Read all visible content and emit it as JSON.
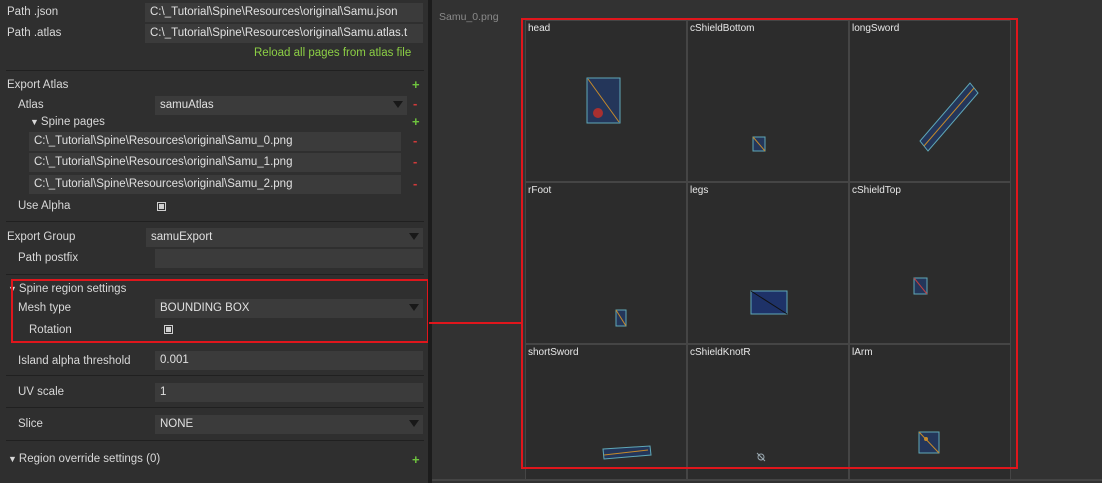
{
  "paths": {
    "json_label": "Path .json",
    "json_value": "C:\\_Tutorial\\Spine\\Resources\\original\\Samu.json",
    "atlas_label": "Path .atlas",
    "atlas_value": "C:\\_Tutorial\\Spine\\Resources\\original\\Samu.atlas.t",
    "reload_link": "Reload all pages from atlas file"
  },
  "export_atlas": {
    "label": "Export Atlas",
    "atlas_label": "Atlas",
    "atlas_value": "samuAtlas",
    "spine_pages_label": "Spine pages",
    "pages": [
      "C:\\_Tutorial\\Spine\\Resources\\original\\Samu_0.png",
      "C:\\_Tutorial\\Spine\\Resources\\original\\Samu_1.png",
      "C:\\_Tutorial\\Spine\\Resources\\original\\Samu_2.png"
    ],
    "use_alpha_label": "Use Alpha",
    "use_alpha_checked": true
  },
  "export_group": {
    "label": "Export Group",
    "value": "samuExport",
    "postfix_label": "Path postfix",
    "postfix_value": ""
  },
  "region_settings": {
    "label": "Spine region settings",
    "mesh_label": "Mesh type",
    "mesh_value": "BOUNDING BOX",
    "rotation_label": "Rotation",
    "rotation_checked": true
  },
  "island": {
    "label": "Island alpha threshold",
    "value": "0.001"
  },
  "uv": {
    "label": "UV scale",
    "value": "1"
  },
  "slice": {
    "label": "Slice",
    "value": "NONE"
  },
  "override": {
    "label": "Region override settings (0)"
  },
  "preview": {
    "title": "Samu_0.png",
    "cells": [
      "head",
      "cShieldBottom",
      "longSword",
      "rFoot",
      "legs",
      "cShieldTop",
      "shortSword",
      "cShieldKnotR",
      "lArm"
    ]
  },
  "colors": {
    "highlight": "#e0161c",
    "accent_green": "#6ec43e",
    "remove_red": "#d23a3a",
    "region_outline": "#5fa8b8"
  }
}
